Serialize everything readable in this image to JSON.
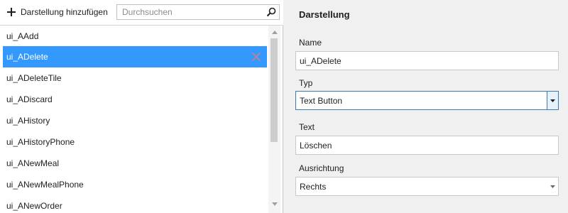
{
  "toolbar": {
    "add_label": "Darstellung hinzufügen",
    "search_placeholder": "Durchsuchen"
  },
  "list": {
    "items": [
      {
        "label": "ui_AAdd",
        "selected": false
      },
      {
        "label": "ui_ADelete",
        "selected": true
      },
      {
        "label": "ui_ADeleteTile",
        "selected": false
      },
      {
        "label": "ui_ADiscard",
        "selected": false
      },
      {
        "label": "ui_AHistory",
        "selected": false
      },
      {
        "label": "ui_AHistoryPhone",
        "selected": false
      },
      {
        "label": "ui_ANewMeal",
        "selected": false
      },
      {
        "label": "ui_ANewMealPhone",
        "selected": false
      },
      {
        "label": "ui_ANewOrder",
        "selected": false
      }
    ]
  },
  "properties": {
    "title": "Darstellung",
    "name_label": "Name",
    "name_value": "ui_ADelete",
    "type_label": "Typ",
    "type_value": "Text Button",
    "text_label": "Text",
    "text_value": "Löschen",
    "alignment_label": "Ausrichtung",
    "alignment_value": "Rechts"
  },
  "colors": {
    "selection": "#3399ff",
    "focus_border": "#3d7ab5",
    "delete_icon": "#d97c7c"
  },
  "icons": {
    "add": "plus-icon",
    "search": "magnifier-icon",
    "delete": "x-icon",
    "dropdown": "triangle-down-icon"
  }
}
